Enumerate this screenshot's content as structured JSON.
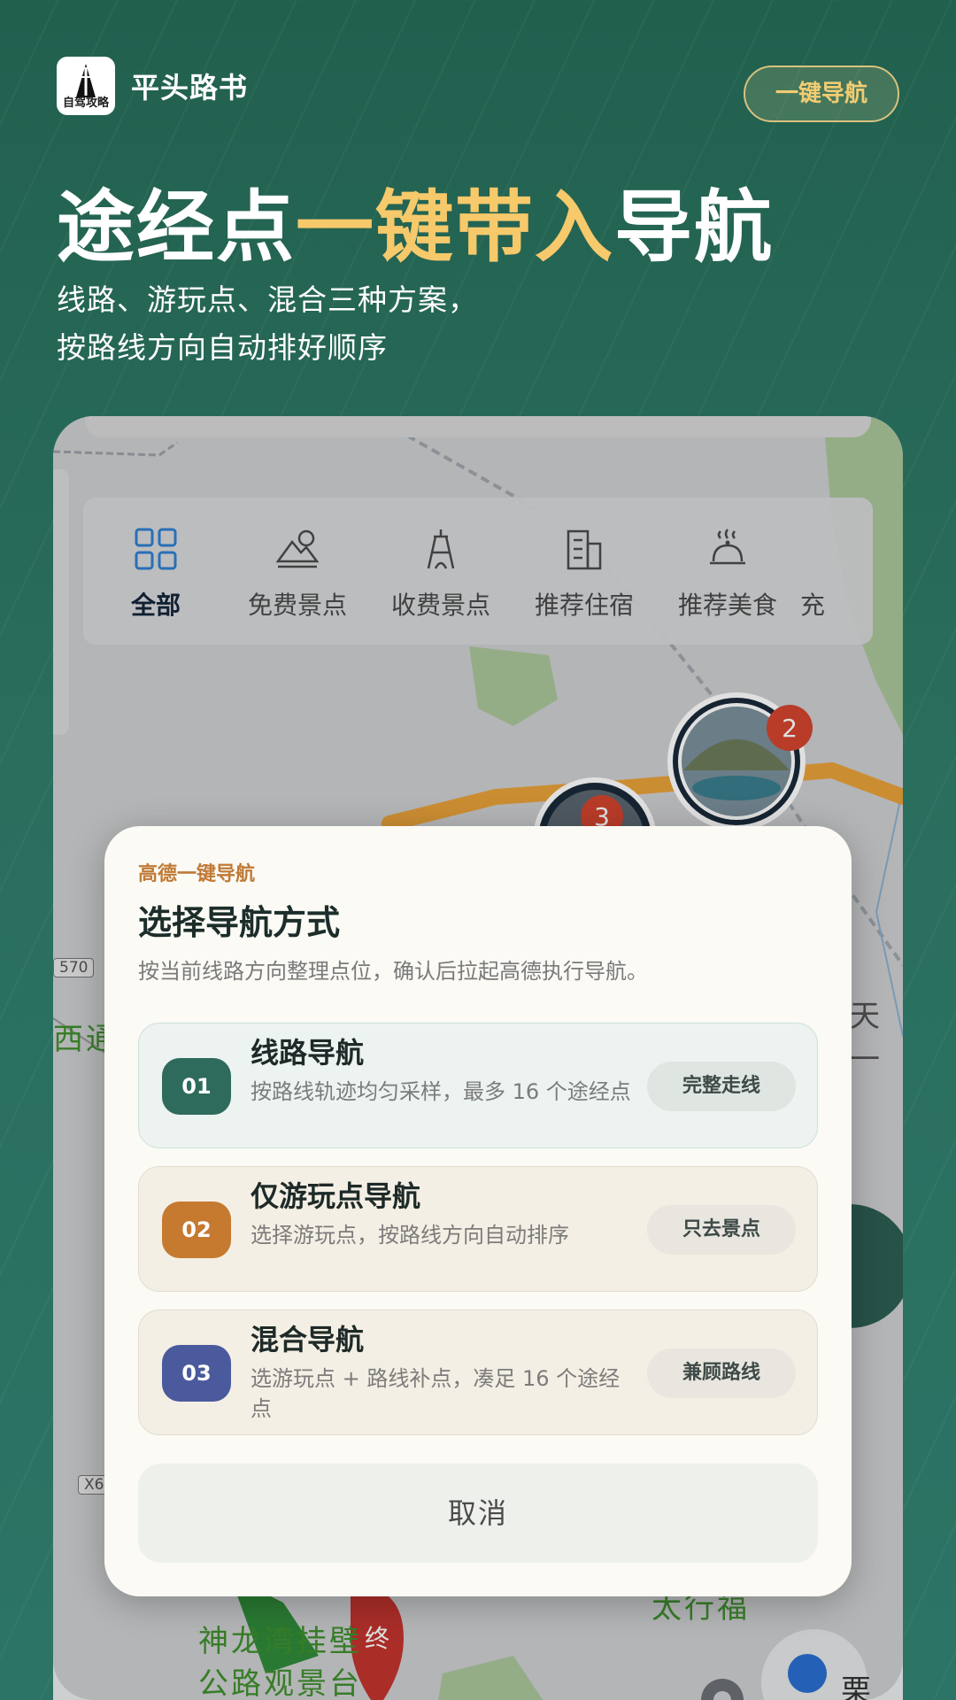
{
  "header": {
    "logo_text": "自驾攻略",
    "brand": "平头路书",
    "nav_button": "一键导航"
  },
  "headline": {
    "part1": "途经点",
    "highlight": "一键带入",
    "part2": "导航"
  },
  "subtitle": {
    "line1": "线路、游玩点、混合三种方案，",
    "line2": "按路线方向自动排好顺序"
  },
  "categories": [
    {
      "label": "全部",
      "icon": "grid-icon",
      "active": true
    },
    {
      "label": "免费景点",
      "icon": "mountain-icon",
      "active": false
    },
    {
      "label": "收费景点",
      "icon": "tower-icon",
      "active": false
    },
    {
      "label": "推荐住宿",
      "icon": "building-icon",
      "active": false
    },
    {
      "label": "推荐美食",
      "icon": "food-cloche-icon",
      "active": false
    },
    {
      "label": "充",
      "icon": "",
      "active": false
    }
  ],
  "map": {
    "markers": [
      {
        "badge": "2"
      },
      {
        "badge": "3"
      }
    ],
    "labels": [
      "西通",
      "天一",
      "神龙湾挂壁",
      "公路观景台",
      "太行福",
      "栗园"
    ],
    "road_codes": [
      "570",
      "X6"
    ],
    "end_marker": "终"
  },
  "dialog": {
    "kicker": "高德一键导航",
    "title": "选择导航方式",
    "description": "按当前线路方向整理点位，确认后拉起高德执行导航。",
    "options": [
      {
        "num": "01",
        "title": "线路导航",
        "desc": "按路线轨迹均匀采样，最多 16 个途经点",
        "tag": "完整走线",
        "color": "#2f6b5c"
      },
      {
        "num": "02",
        "title": "仅游玩点导航",
        "desc": "选择游玩点，按路线方向自动排序",
        "tag": "只去景点",
        "color": "#c57a30"
      },
      {
        "num": "03",
        "title": "混合导航",
        "desc": "选游玩点 + 路线补点，凑足 16 个途经点",
        "tag": "兼顾路线",
        "color": "#4a5a9c"
      }
    ],
    "cancel": "取消"
  }
}
